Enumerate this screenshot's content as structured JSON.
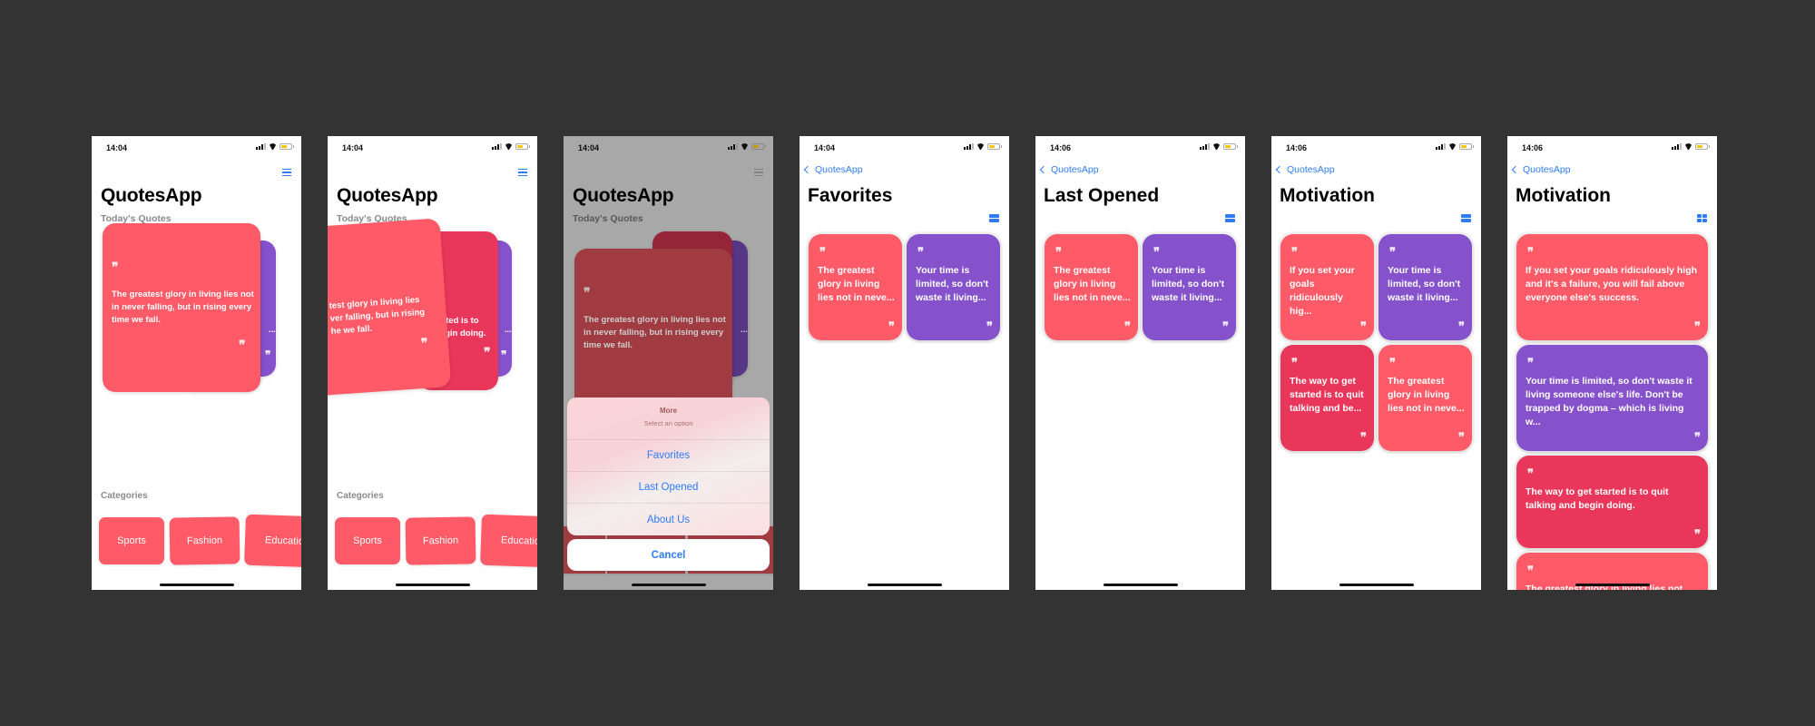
{
  "screens": [
    {
      "status_time": "14:04",
      "title": "QuotesApp",
      "subtitle": "Today's Quotes",
      "front_quote": "The greatest glory in living lies not in never falling, but in rising every time we fall.",
      "categories_label": "Categories",
      "categories": [
        "Sports",
        "Fashion",
        "Education"
      ]
    },
    {
      "status_time": "14:04",
      "title": "QuotesApp",
      "subtitle": "Today's Quotes",
      "front_quote": "The greatest glory in living lies not in never falling, but in rising every time we fall.",
      "front_quote_visible": "test glory in living lies\nver falling, but in rising\nhe we fall.",
      "second_quote_visible": "tarted is to\nbegin doing.",
      "categories_label": "Categories",
      "categories": [
        "Sports",
        "Fashion",
        "Education"
      ]
    },
    {
      "status_time": "14:04",
      "title": "QuotesApp",
      "subtitle": "Today's Quotes",
      "front_quote": "The greatest glory in living lies not in never falling, but in rising every time we fall.",
      "action_sheet": {
        "title": "More",
        "message": "Select an option",
        "options": [
          "Favorites",
          "Last Opened",
          "About Us"
        ],
        "cancel": "Cancel"
      }
    },
    {
      "status_time": "14:04",
      "back_label": "QuotesApp",
      "title": "Favorites",
      "quotes": [
        {
          "text": "The greatest glory in living lies not in neve...",
          "color": "#fe5a67"
        },
        {
          "text": "Your time is limited, so don't waste it living...",
          "color": "#8652cc"
        }
      ]
    },
    {
      "status_time": "14:06",
      "back_label": "QuotesApp",
      "title": "Last Opened",
      "quotes": [
        {
          "text": "The greatest glory in living lies not in neve...",
          "color": "#fe5a67"
        },
        {
          "text": "Your time is limited, so don't waste it living...",
          "color": "#8652cc"
        }
      ]
    },
    {
      "status_time": "14:06",
      "back_label": "QuotesApp",
      "title": "Motivation",
      "layout": "grid",
      "quotes": [
        {
          "text": "If you set your goals ridiculously hig...",
          "color": "#fe5a67"
        },
        {
          "text": "Your time is limited, so don't waste it living...",
          "color": "#8652cc"
        },
        {
          "text": "The way to get started is to quit talking and be...",
          "color": "#e8375a"
        },
        {
          "text": "The greatest glory in living lies not in neve...",
          "color": "#fe5a67"
        }
      ]
    },
    {
      "status_time": "14:06",
      "back_label": "QuotesApp",
      "title": "Motivation",
      "layout": "list",
      "quotes": [
        {
          "text": "If you set your goals ridiculously high and it's a failure, you will fail above everyone else's success.",
          "color": "#fe5a67"
        },
        {
          "text": "Your time is limited, so don't waste it living someone else's life. Don't be trapped by dogma – which is living w...",
          "color": "#8652cc"
        },
        {
          "text": "The way to get started is to quit talking and begin doing.",
          "color": "#e8375a"
        },
        {
          "text": "The greatest glory in living lies not in...",
          "color": "#fe5a67"
        }
      ]
    }
  ],
  "icons": {
    "quote_open": "❞",
    "quote_close": "❞",
    "ellipsis": "..."
  },
  "colors": {
    "background": "#333333",
    "accent": "#2f7cf6",
    "card_red": "#fe5a67",
    "card_crimson": "#e8375a",
    "card_purple": "#8652cc"
  }
}
